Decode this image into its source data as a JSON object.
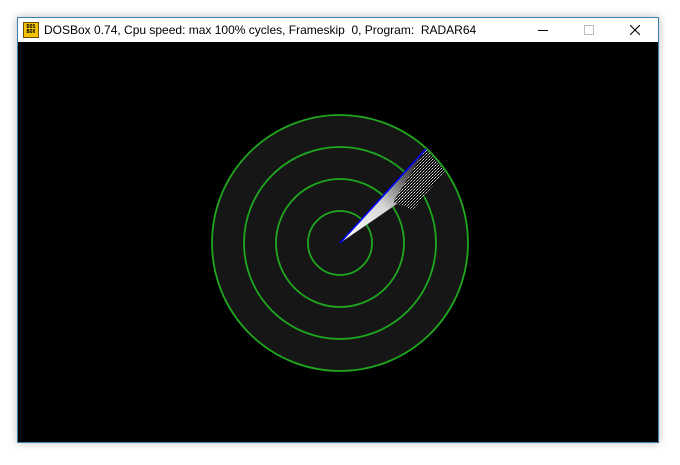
{
  "window": {
    "title": "DOSBox 0.74, Cpu speed: max 100% cycles, Frameskip  0, Program:  RADAR64",
    "app_icon": "dosbox-icon",
    "app_icon_text": "DOS\nBOX",
    "controls": {
      "minimize_icon": "minimize-icon",
      "maximize_icon": "maximize-icon",
      "close_icon": "close-icon"
    }
  },
  "radar": {
    "ring_count": 4,
    "sweep_angle_deg": -45,
    "colors": {
      "background": "#000000",
      "disc": "#161616",
      "rings": "#1fa81f",
      "sweep_edge": "#0000ff",
      "sweep_fill": "#ffffff"
    }
  }
}
